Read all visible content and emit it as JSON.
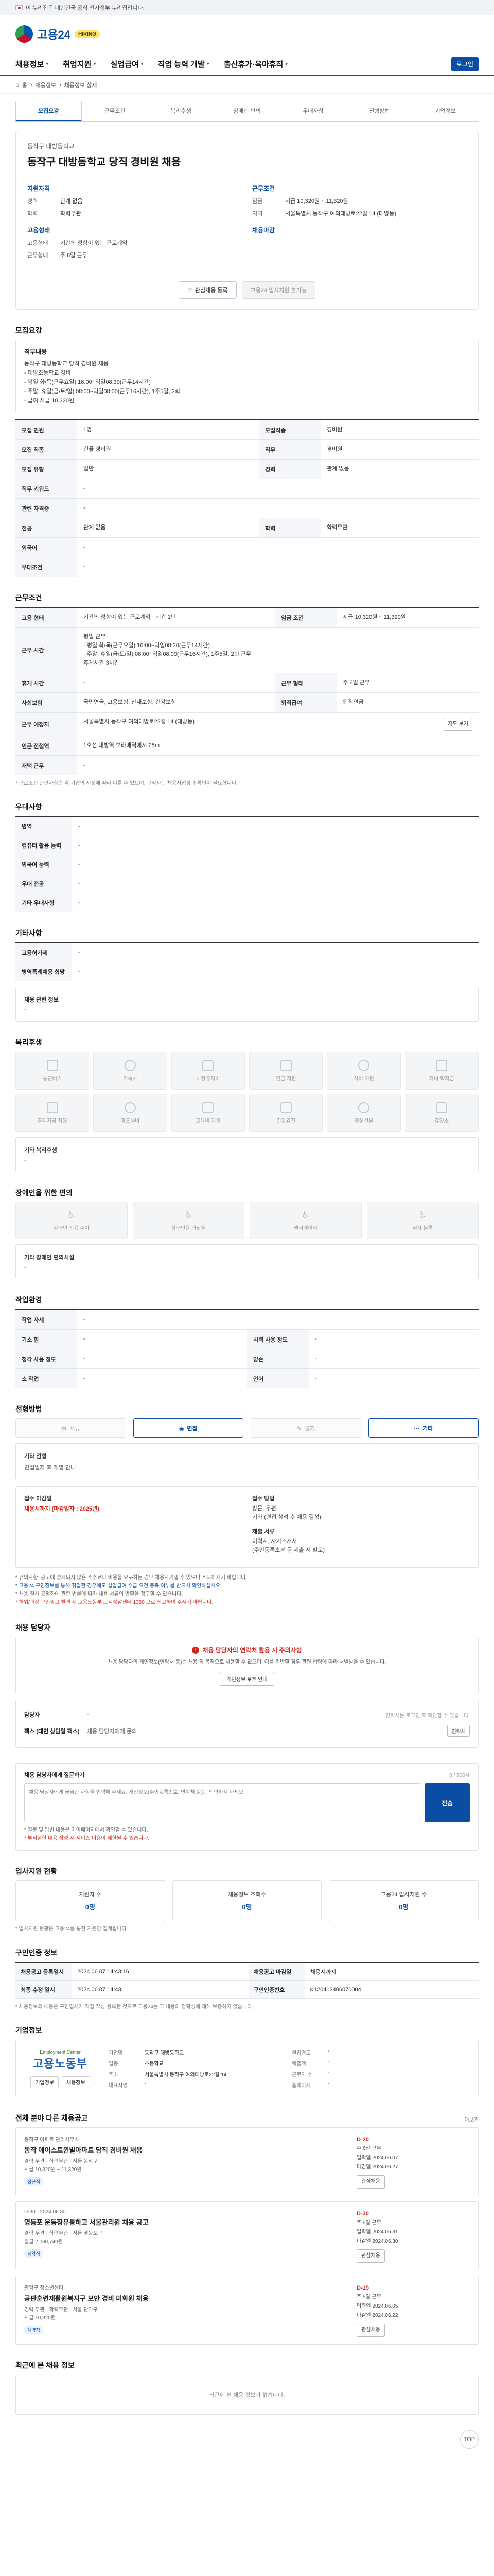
{
  "gov_banner": "이 누리집은 대한민국 공식 전자정부 누리집입니다.",
  "brand": {
    "name": "고용24",
    "badge": "HIRING"
  },
  "gnb": [
    "채용정보",
    "취업지원",
    "실업급여",
    "직업 능력 개발",
    "출산휴가·육아휴직"
  ],
  "gnb_login": "로그인",
  "breadcrumb": [
    "홈",
    "채용정보",
    "채용정보 상세"
  ],
  "tabs": [
    "모집요강",
    "근무조건",
    "복리후생",
    "장애인 편의",
    "우대사항",
    "전형방법",
    "기업정보"
  ],
  "job": {
    "company": "동작구 대방동학교",
    "title": "동작구 대방동학교 당직 경비원 채용",
    "left_header": "지원자격",
    "left_rows": [
      {
        "k": "경력",
        "v": "관계 없음"
      },
      {
        "k": "학력",
        "v": "학력무관"
      }
    ],
    "left_header2": "고용형태",
    "left_rows2": [
      {
        "k": "고용형태",
        "v": "기간의 정함이 있는 근로계약"
      },
      {
        "k": "근무형태",
        "v": "주 6일 근무"
      }
    ],
    "right_header": "근무조건",
    "right_rows": [
      {
        "k": "임금",
        "v": "시급 10,320원 ~ 11,320원"
      },
      {
        "k": "지역",
        "v": "서울특별시 동작구 여의대방로22길 14 (대방동)"
      }
    ],
    "right_header2": "채용마감",
    "right_rows2": [],
    "btn_save": "관심채용 등록",
    "btn_apply": "고용24 입사지원 불가능"
  },
  "recruit": {
    "title": "모집요강",
    "desc_title": "직무내용",
    "desc": "동작구 대방동학교 당직 경비원 채용\n- 대방초등학교 경비\n- 평일 화/목(근무요일) 16:00~익일08:30(근무14시간)\n- 주말, 휴일(금/토/일) 08:00~익일08:00(근무16시간), 1주5일, 2회\n- 급여 시급 10,320원",
    "table": [
      [
        "모집 인원",
        "1명",
        "모집직종",
        "경비원"
      ],
      [
        "모집 직종",
        "건물 경비원",
        "직무",
        "경비원"
      ],
      [
        "모집 유형",
        "일반",
        "경력",
        "관계 없음"
      ],
      [
        "직무 키워드",
        "-",
        "",
        ""
      ],
      [
        "관련 자격증",
        "-",
        "",
        ""
      ],
      [
        "전공",
        "관계 없음",
        "학력",
        "학력무관"
      ],
      [
        "외국어",
        "-",
        "",
        ""
      ],
      [
        "우대조건",
        "-",
        "",
        ""
      ]
    ]
  },
  "work": {
    "title": "근무조건",
    "rows": [
      [
        "고용 형태",
        "기간의 정함이 있는 근로계약 · 기간 1년",
        "임금 조건",
        "시급 10,320원 ~ 11,320원"
      ],
      [
        "근무 시간",
        "평일 근무\n· 평일 화/목(근무요일) 16:00~익일08:30(근무14시간)\n· 주말, 휴일(금/토/일) 08:00~익일08:00(근무16시간), 1주5일, 2회 근무\n휴게시간 3시간",
        "",
        ""
      ],
      [
        "휴게 시간",
        "-",
        "근무 형태",
        "주 6일 근무"
      ],
      [
        "사회보험",
        "국민연금, 고용보험, 산재보험, 건강보험",
        "퇴직급여",
        "퇴직연금"
      ],
      [
        "근무 예정지",
        "서울특별시 동작구 여의대방로22길 14 (대방동)",
        "",
        ""
      ],
      [
        "인근 전철역",
        "1호선 대방역 보라매역에서 25m",
        "",
        ""
      ],
      [
        "재택 근무",
        "-",
        "",
        ""
      ]
    ],
    "map_btn": "지도 보기",
    "note": "* 근로조건 관련사항은 각 기업의 사정에 따라 다를 수 있으며, 구직자는 채용사업장과 확인이 필요합니다."
  },
  "pref": {
    "title": "우대사항",
    "rows": [
      [
        "병역",
        "-"
      ],
      [
        "컴퓨터 활용 능력",
        "-"
      ],
      [
        "외국어 능력",
        "-"
      ],
      [
        "우대 전공",
        "-"
      ],
      [
        "기타 우대사항",
        "-"
      ]
    ]
  },
  "other": {
    "title": "기타사항",
    "rows": [
      [
        "고용허가제",
        "-"
      ],
      [
        "병역특례채용 희망",
        "-"
      ]
    ],
    "extra_label": "채용 관련 정보",
    "extra_value": "-"
  },
  "welfare": {
    "title": "복리후생",
    "items": [
      "통근버스",
      "기숙사",
      "차량유지비",
      "연금 지원",
      "식비 지원",
      "자녀 학자금",
      "주택자금 지원",
      "경조사비",
      "교육비 지원",
      "건강검진",
      "명절선물",
      "휴양소"
    ],
    "extra": "기타 복리후생",
    "extra_value": "-"
  },
  "disab": {
    "title": "장애인을 위한 편의",
    "items": [
      "장애인 전용 주차",
      "장애인용 화장실",
      "엘리베이터",
      "점자 블록"
    ],
    "extra": "기타 장애인 편의시설",
    "extra_value": "-"
  },
  "workenv": {
    "title": "작업환경",
    "rows": [
      [
        "작업 자세",
        "-",
        "",
        ""
      ],
      [
        "기소 힘",
        "-",
        "시력 사용 정도",
        "-"
      ],
      [
        "청각 사용 정도",
        "-",
        "양손",
        "-"
      ],
      [
        "소 작업",
        "-",
        "언어",
        "-"
      ]
    ]
  },
  "process": {
    "title": "전형방법",
    "steps": [
      "서류",
      "면접",
      "필기",
      "기타"
    ],
    "extra_label": "기타 전형",
    "extra_value": "면접일자 후 개별 안내",
    "apply": {
      "deadline_label": "접수 마감일",
      "deadline": "채용시까지 (마감일자 : 2025년)",
      "method_label": "접수 방법",
      "method": "방문, 우편,\n기타 (면접 참석 후 채용 결정)",
      "docs_label": "제출 서류",
      "docs": "이력서, 자기소개서\n(주민등록초본 등 제출 시 별도)"
    },
    "warnings": [
      "* 유의사항: 공고에 명시되지 않은 수수료나 비용을 요구하는 경우 채용사기일 수 있으니 주의하시기 바랍니다.",
      "* 고용24 구인정보를 통해 취업한 경우에도 실업급여 수급 요건 충족 여부를 반드시 확인하십시오.",
      "* 채용 절차 공정화에 관한 법률에 따라 채용 서류의 반환을 청구할 수 있습니다.",
      "* 허위/과장 구인광고 발견 시 고용노동부 고객상담센터 1350 으로 신고하여 주시기 바랍니다."
    ]
  },
  "contact": {
    "title": "채용 담당자",
    "alert_head": "채용 담당자의 연락처 활용 시 주의사항",
    "alert_body": "채용 담당자의 개인정보(연락처 등)는 채용 외 목적으로 사용할 수 없으며, 이를 위반할 경우 관련 법령에 따라 처벌받을 수 있습니다.",
    "alert_btn": "개인정보 보호 안내",
    "rows": [
      {
        "k": "담당자",
        "v": "-"
      },
      {
        "k": "팩스 (대면 상담일 팩스)",
        "v": "채용 담당자에게 문의"
      }
    ],
    "contact_btn": "연락처",
    "hint": "연락처는 로그인 후 확인할 수 있습니다."
  },
  "inquiry": {
    "title": "채용 담당자에게 질문하기",
    "counter": "0 / 500자",
    "placeholder": "채용 담당자에게 궁금한 사항을 입력해 주세요. 개인정보(주민등록번호, 연락처 등)는 입력하지 마세요.",
    "send": "전송",
    "notes": [
      "* 질문 및 답변 내용은 마이페이지에서 확인할 수 있습니다.",
      "* 부적절한 내용 작성 시 서비스 이용이 제한될 수 있습니다."
    ]
  },
  "stats": {
    "title": "입사지원 현황",
    "cards": [
      {
        "label": "지원자 수",
        "val": "0명"
      },
      {
        "label": "채용정보 조회수",
        "val": "0명"
      },
      {
        "label": "고용24 입사지원 수",
        "val": "0명"
      }
    ],
    "note": "* 입사지원 현황은 고용24를 통한 지원만 집계됩니다."
  },
  "info": {
    "title": "구인인증 정보",
    "rows": [
      [
        "채용공고 등록일시",
        "2024.06.07 14:43:16",
        "채용공고 마감일",
        "채용시까지"
      ],
      [
        "최종 수정 일시",
        "2024.06.07 14:43",
        "구인인증번호",
        "K120412406070004"
      ]
    ],
    "note": "* 채용정보의 내용은 구인업체가 직접 작성·등록한 것으로 고용24는 그 내용의 정확성에 대해 보증하지 않습니다."
  },
  "agency": {
    "title": "기업정보",
    "logo_small": "Employment Center",
    "logo_big": "고용노동부",
    "fields": [
      [
        "기업명",
        "동작구 대방동학교",
        "설립연도",
        "-"
      ],
      [
        "업종",
        "초등학교",
        "매출액",
        "-"
      ],
      [
        "주소",
        "서울특별시 동작구 여의대방로22길 14",
        "근로자 수",
        "-"
      ],
      [
        "대표자명",
        "-",
        "홈페이지",
        "-"
      ]
    ],
    "btns": [
      "기업정보",
      "채용정보"
    ]
  },
  "recommended": {
    "title": "전체 분야 다른 채용공고",
    "more": "더보기",
    "items": [
      {
        "company": "동작구 아파트 관리사무소",
        "title": "동작 에이스트윈빌아파트 당직 경비원 채용",
        "meta": "경력 무관 · 학력무관 · 서울 동작구\n시급 10,320원 ~ 11,320원",
        "badges": [
          "정규직"
        ],
        "dday": "D-20",
        "right": "주 6일 근무\n입력일 2024.06.07\n마감일 2024.06.27",
        "btn": "관심채용"
      },
      {
        "company": "D-30 · 2024.06.30",
        "title": "영등포 운동장유통하고 서울관리원 채용 공고",
        "meta": "경력 무관 · 학력무관 · 서울 영등포구\n월급 2,060,740원",
        "badges": [
          "계약직"
        ],
        "dday": "D-30",
        "right": "주 5일 근무\n입력일 2024.05.31\n마감일 2024.06.30",
        "btn": "관심채용"
      },
      {
        "company": "관악구 청소년센터",
        "title": "공판훈련재활원복지구 보안 경비 미화원 채용",
        "meta": "경력 무관 · 학력무관 · 서울 관악구\n시급 10,320원",
        "badges": [
          "계약직"
        ],
        "dday": "D-15",
        "right": "주 5일 근무\n입력일 2024.06.05\n마감일 2024.06.22",
        "btn": "관심채용"
      }
    ]
  },
  "recent": {
    "title": "최근에 본 채용 정보",
    "empty": "최근에 본 채용 정보가 없습니다."
  },
  "top_btn": "TOP"
}
